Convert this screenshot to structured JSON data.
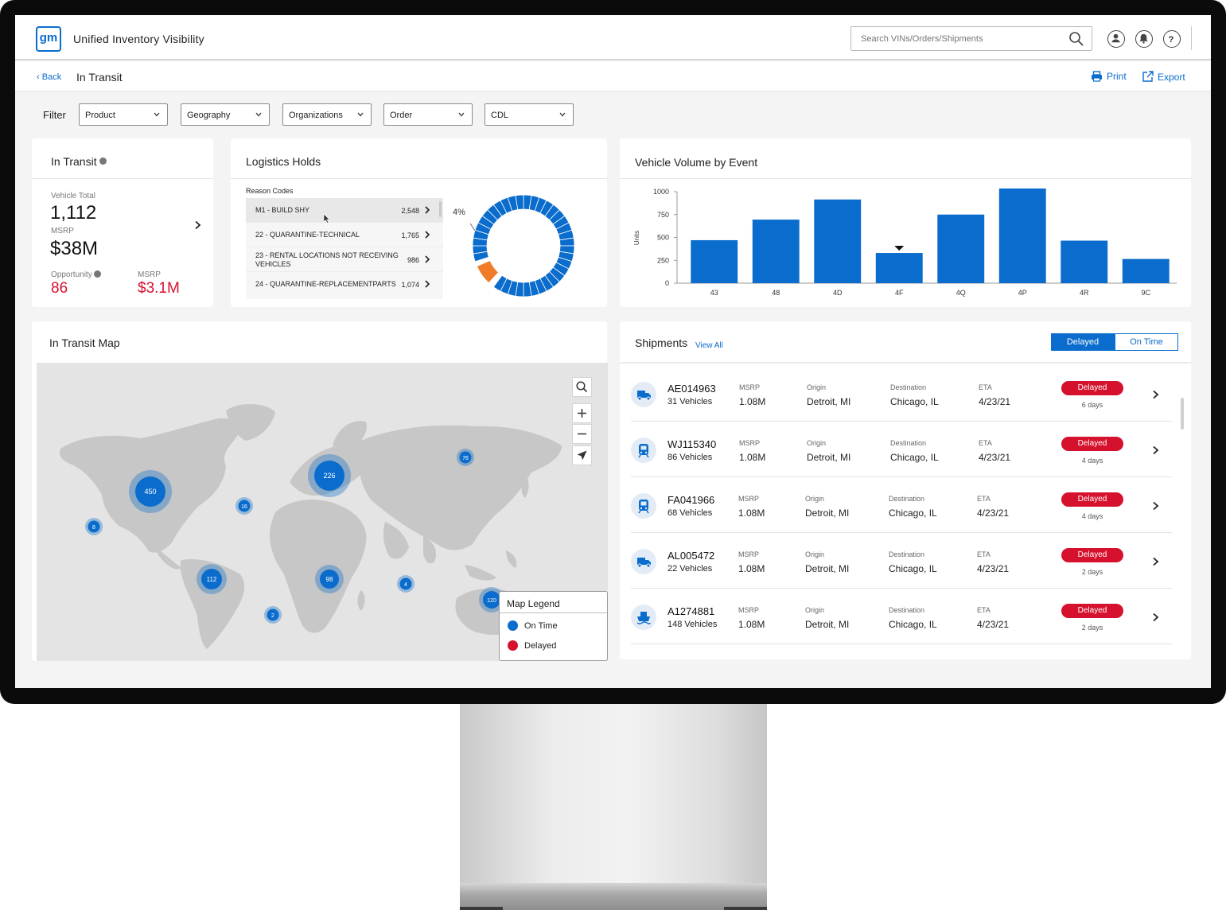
{
  "app": {
    "logo_text": "gm",
    "title": "Unified Inventory Visibility"
  },
  "search": {
    "placeholder": "Search VINs/Orders/Shipments"
  },
  "breadcrumb": {
    "back_label": "Back",
    "page_title": "In Transit"
  },
  "actions": {
    "print_label": "Print",
    "export_label": "Export"
  },
  "filter": {
    "label": "Filter",
    "selects": [
      "Product",
      "Geography",
      "Organizations",
      "Order",
      "CDL"
    ]
  },
  "in_transit": {
    "title": "In Transit",
    "vehicle_total_label": "Vehicle Total",
    "vehicle_total": "1,112",
    "msrp_label": "MSRP",
    "msrp_value": "$38M",
    "opportunity_label": "Opportunity",
    "opportunity_value": "86",
    "opportunity_msrp_label": "MSRP",
    "opportunity_msrp_value": "$3.1M"
  },
  "logistics_holds": {
    "title": "Logistics Holds",
    "reason_codes_label": "Reason Codes",
    "rows": [
      {
        "label": "M1 - BUILD SHY",
        "value": "2,548"
      },
      {
        "label": "22 - QUARANTINE-TECHNICAL",
        "value": "1,765"
      },
      {
        "label": "23 - RENTAL LOCATIONS NOT RECEIVING VEHICLES",
        "value": "986"
      },
      {
        "label": "24 - QUARANTINE-REPLACEMENTPARTS",
        "value": "1,074"
      }
    ],
    "donut_percent_label": "4%",
    "donut_highlight_fraction": 0.04,
    "colors": {
      "primary": "#0a6ccc",
      "highlight": "#f07c2a"
    }
  },
  "volume_chart": {
    "title": "Vehicle Volume by Event",
    "chart_data": {
      "type": "bar",
      "categories": [
        "43",
        "48",
        "4D",
        "4F",
        "4Q",
        "4P",
        "4R",
        "9C"
      ],
      "values": [
        470,
        695,
        915,
        330,
        750,
        1035,
        465,
        265
      ],
      "ylabel": "Units",
      "ylim": [
        0,
        1000
      ],
      "yticks": [
        "1000",
        "750",
        "500",
        "250",
        "0"
      ],
      "bar_color": "#0a6ccc",
      "marker_category": "4F"
    }
  },
  "map": {
    "title": "In Transit Map",
    "clusters": [
      "450",
      "226",
      "76",
      "16",
      "8",
      "112",
      "98",
      "4",
      "2",
      "120"
    ],
    "legend": {
      "title": "Map Legend",
      "on_time_label": "On Time",
      "delayed_label": "Delayed",
      "on_time_color": "#0a6ccc",
      "delayed_color": "#d6112e"
    }
  },
  "shipments": {
    "title": "Shipments",
    "view_all_label": "View All",
    "toggle": {
      "delayed_label": "Delayed",
      "on_time_label": "On Time",
      "active": "Delayed"
    },
    "column_labels": {
      "msrp": "MSRP",
      "origin": "Origin",
      "destination": "Destination",
      "eta": "ETA"
    },
    "rows": [
      {
        "id": "AE014963",
        "vehicles": "31 Vehicles",
        "msrp": "1.08M",
        "origin": "Detroit, MI",
        "destination": "Chicago, IL",
        "eta": "4/23/21",
        "status": "Delayed",
        "days": "6 days",
        "icon": "truck-icon"
      },
      {
        "id": "WJ115340",
        "vehicles": "86 Vehicles",
        "msrp": "1.08M",
        "origin": "Detroit, MI",
        "destination": "Chicago, IL",
        "eta": "4/23/21",
        "status": "Delayed",
        "days": "4 days",
        "icon": "train-icon"
      },
      {
        "id": "FA041966",
        "vehicles": "68 Vehicles",
        "msrp": "1.08M",
        "origin": "Detroit, MI",
        "destination": "Chicago, IL",
        "eta": "4/23/21",
        "status": "Delayed",
        "days": "4 days",
        "icon": "train-icon"
      },
      {
        "id": "AL005472",
        "vehicles": "22 Vehicles",
        "msrp": "1.08M",
        "origin": "Detroit, MI",
        "destination": "Chicago, IL",
        "eta": "4/23/21",
        "status": "Delayed",
        "days": "2 days",
        "icon": "truck-icon"
      },
      {
        "id": "A1274881",
        "vehicles": "148 Vehicles",
        "msrp": "1.08M",
        "origin": "Detroit, MI",
        "destination": "Chicago, IL",
        "eta": "4/23/21",
        "status": "Delayed",
        "days": "2 days",
        "icon": "ship-icon"
      }
    ]
  }
}
